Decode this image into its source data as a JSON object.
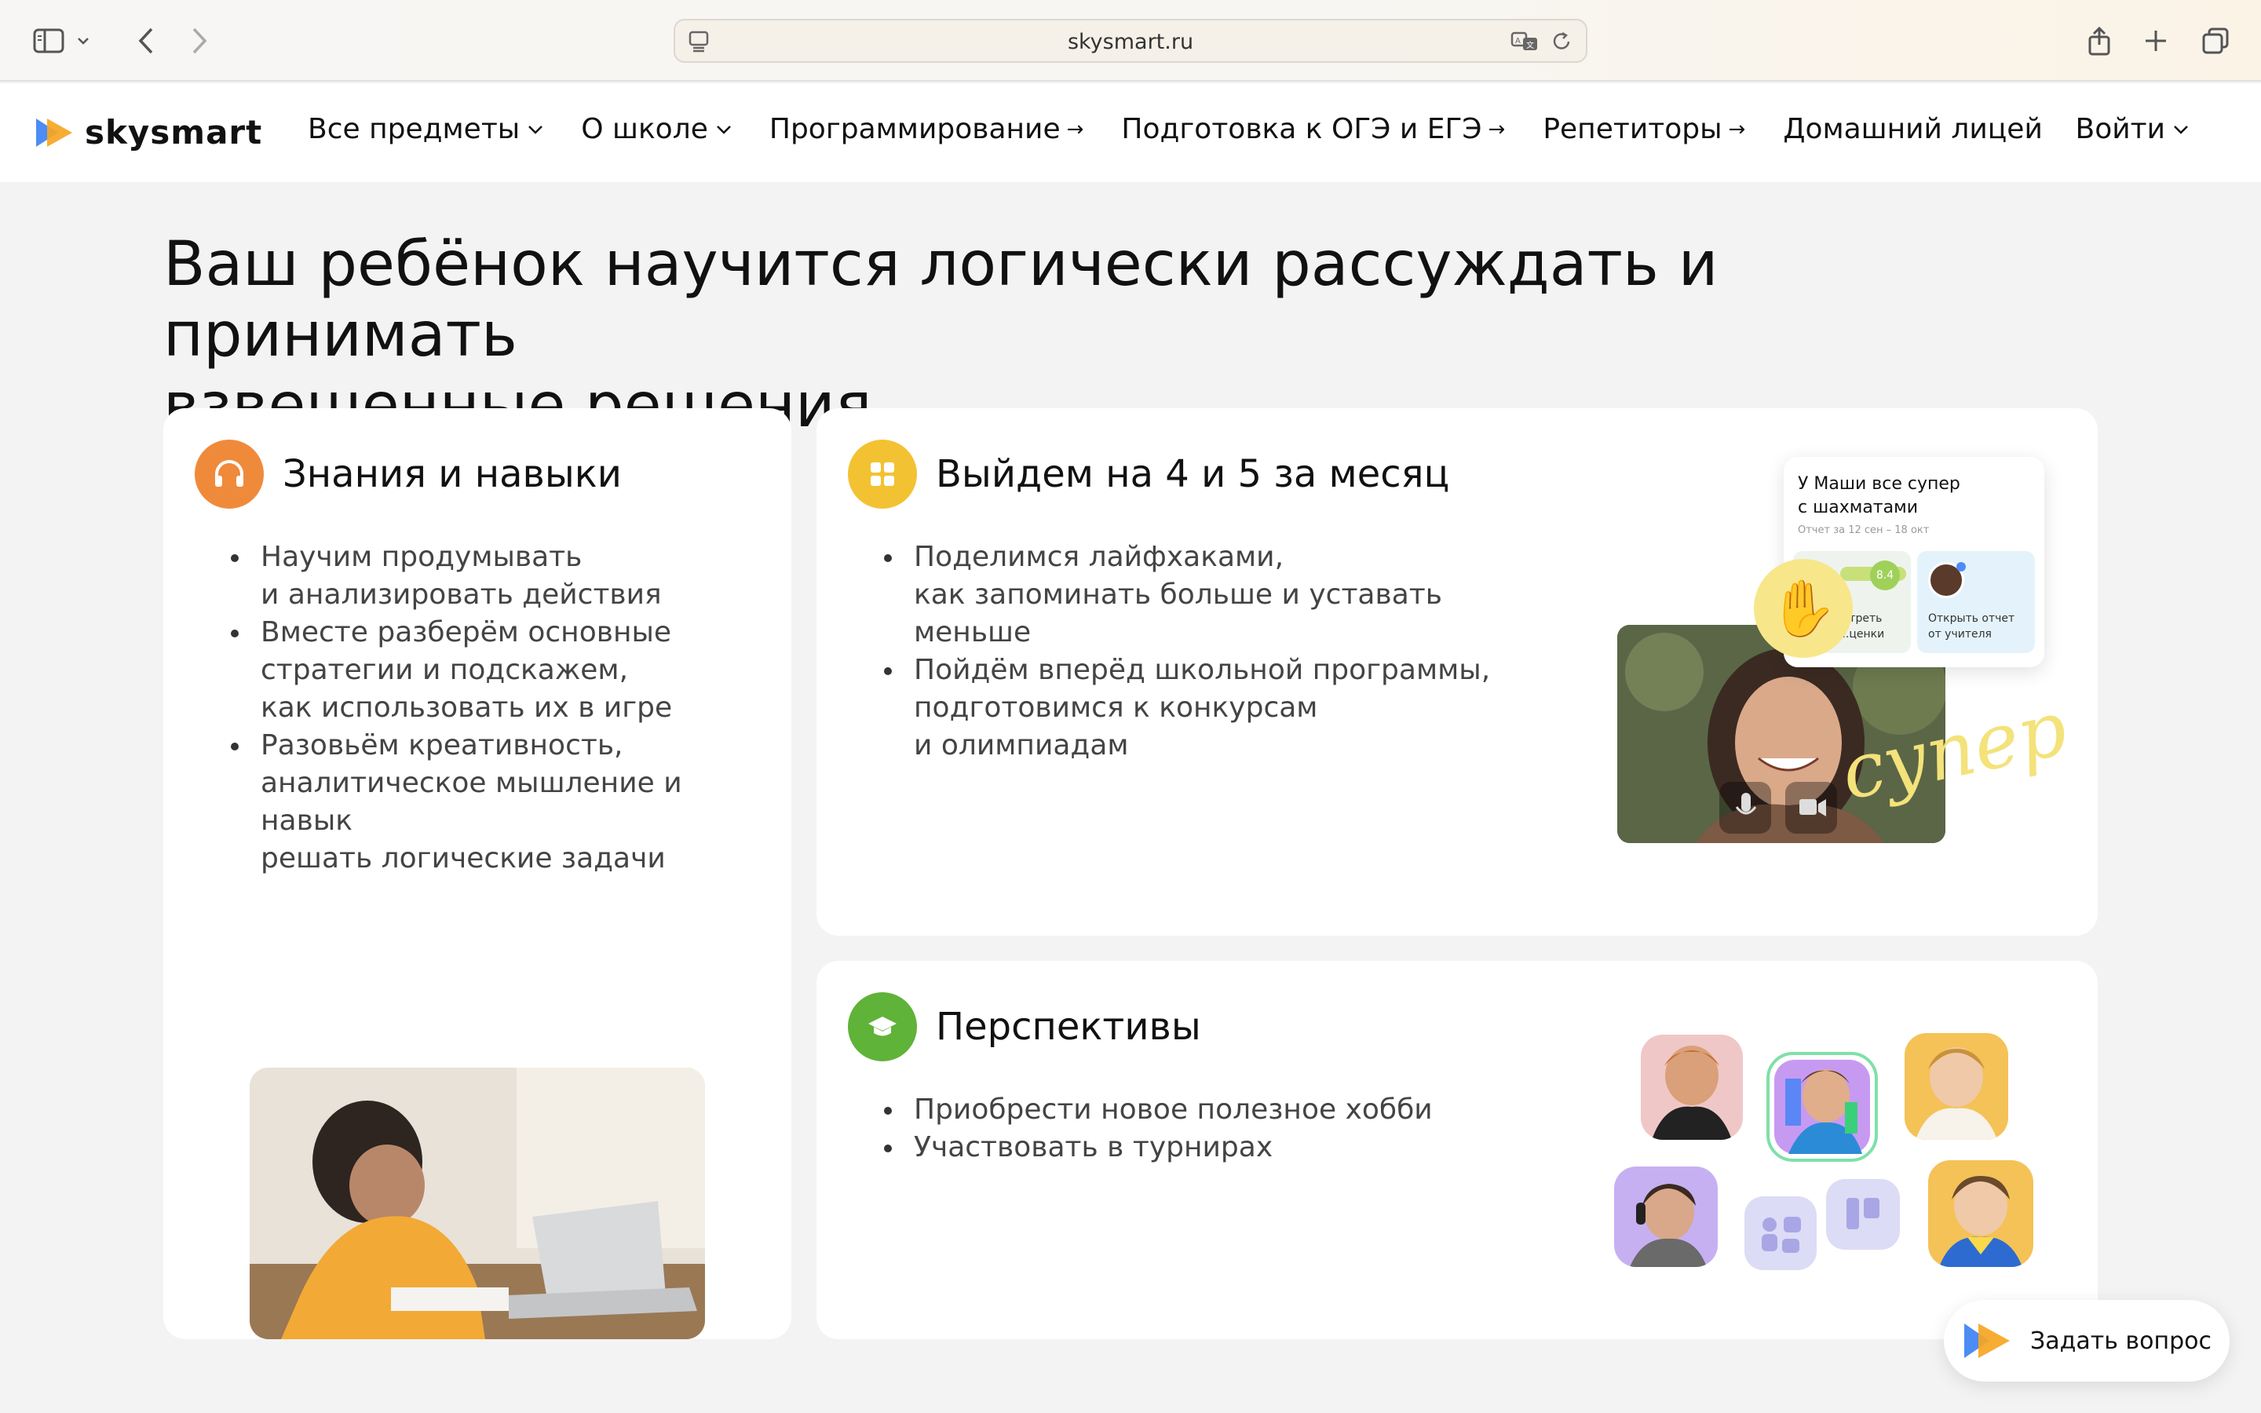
{
  "browser": {
    "url": "skysmart.ru"
  },
  "header": {
    "logo_text": "skysmart",
    "nav": [
      {
        "label": "Все предметы",
        "type": "dropdown"
      },
      {
        "label": "О школе",
        "type": "dropdown"
      },
      {
        "label": "Программирование",
        "type": "link"
      },
      {
        "label": "Подготовка к ОГЭ и ЕГЭ",
        "type": "link"
      },
      {
        "label": "Репетиторы",
        "type": "link"
      },
      {
        "label": "Домашний лицей",
        "type": "plain"
      }
    ],
    "login_label": "Войти"
  },
  "main": {
    "headline_line1": "Ваш ребёнок научится логически рассуждать и принимать",
    "headline_line2": "взвешенные решения",
    "cards": [
      {
        "title": "Знания и навыки",
        "icon": "headphones-icon",
        "icon_color": "#f08a3b",
        "bullets": [
          [
            "Научим продумывать",
            "и анализировать действия"
          ],
          [
            "Вместе разберём основные",
            "стратегии и подскажем,",
            "как использовать их в игре"
          ],
          [
            "Разовьём креативность,",
            "аналитическое мышление и навык",
            "решать логические задачи"
          ]
        ]
      },
      {
        "title": "Выйдем на 4 и 5 за месяц",
        "icon": "grid-icon",
        "icon_color": "#f3c232",
        "bullets": [
          [
            "Поделимся лайфхаками,",
            "как запоминать больше и уставать",
            "меньше"
          ],
          [
            "Пойдём вперёд школьной программы,",
            "подготовимся к конкурсам",
            "и олимпиадам"
          ]
        ]
      },
      {
        "title": "Перспективы",
        "icon": "graduation-cap-icon",
        "icon_color": "#5fb338",
        "bullets": [
          [
            "Приобрести новое полезное хобби"
          ],
          [
            "Участвовать в турнирах"
          ]
        ]
      }
    ],
    "report": {
      "title_line1": "У Маши все супер",
      "title_line2": "с шахматами",
      "date": "Отчет за 12 сен – 18 окт",
      "score": "8.4",
      "left_label_line1": "...треть",
      "left_label_line2": "...ценки",
      "right_label_line1": "Открыть отчет",
      "right_label_line2": "от учителя",
      "sticker_text": "супер"
    }
  },
  "floating": {
    "ask_label": "Задать вопрос"
  },
  "colors": {
    "orange": "#f08a3b",
    "yellow": "#f3c232",
    "green": "#5fb338",
    "logo_blue": "#4d8cf5",
    "logo_orange": "#f6a623"
  }
}
